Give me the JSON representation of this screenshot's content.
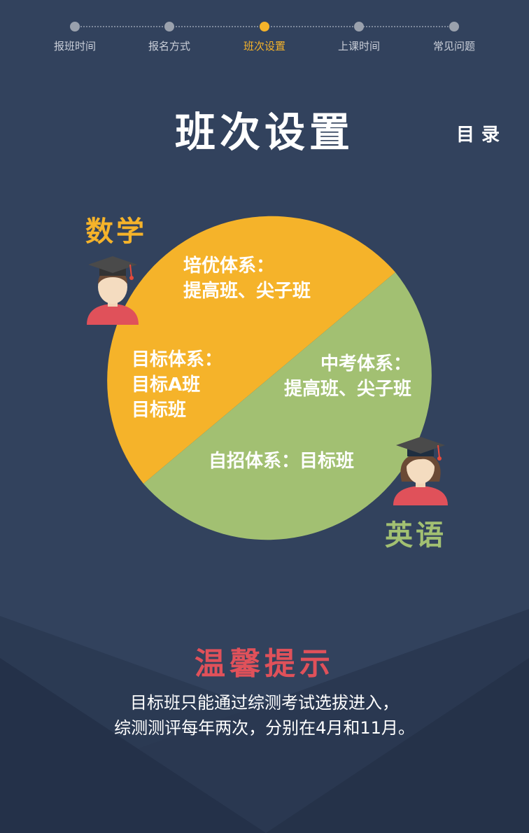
{
  "stepper": {
    "steps": [
      {
        "label": "报班时间",
        "active": false
      },
      {
        "label": "报名方式",
        "active": false
      },
      {
        "label": "班次设置",
        "active": true
      },
      {
        "label": "上课时间",
        "active": false
      },
      {
        "label": "常见问题",
        "active": false
      }
    ]
  },
  "header": {
    "title": "班次设置",
    "toc_label": "目录"
  },
  "subjects": {
    "math": "数学",
    "english": "英语"
  },
  "pie": {
    "math_top": [
      "培优体系：",
      "提高班、尖子班"
    ],
    "math_left": [
      "目标体系：",
      "目标A班",
      "目标班"
    ],
    "english_right": [
      "中考体系：",
      "提高班、尖子班"
    ],
    "english_bottom": "自招体系：目标班"
  },
  "colors": {
    "background": "#32425d",
    "accent": "#f5b32a",
    "green": "#a2c072",
    "tips": "#e0515a"
  },
  "tips": {
    "title": "温馨提示",
    "lines": [
      "目标班只能通过综测考试选拔进入，",
      "综测测评每年两次，分别在4月和11月。"
    ]
  }
}
